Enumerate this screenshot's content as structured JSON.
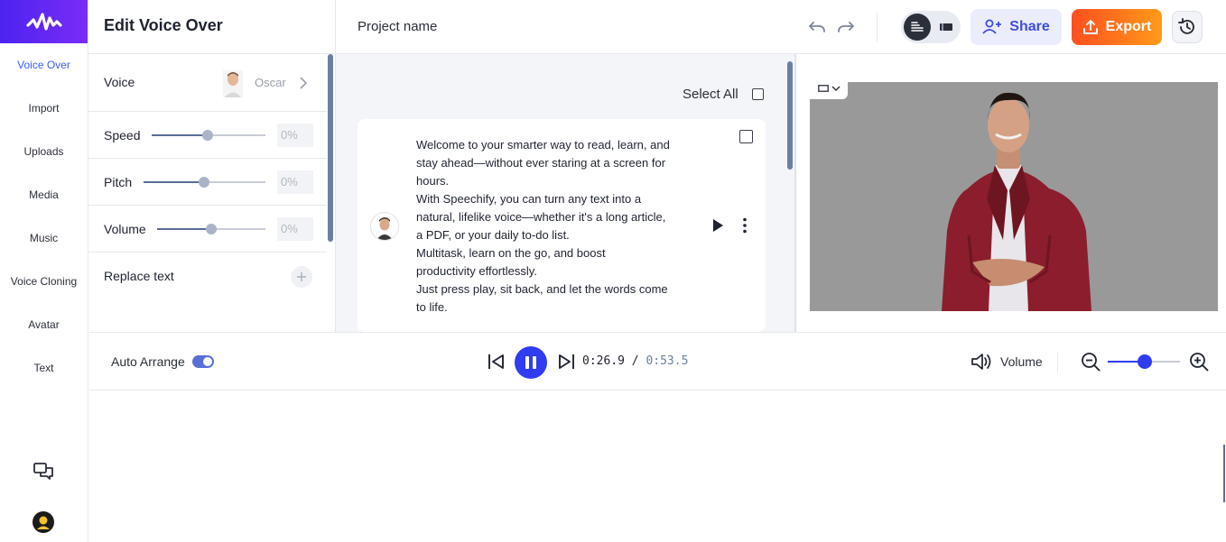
{
  "nav": {
    "items": [
      {
        "label": "Voice Over",
        "active": true
      },
      {
        "label": "Import"
      },
      {
        "label": "Uploads"
      },
      {
        "label": "Media"
      },
      {
        "label": "Music"
      },
      {
        "label": "Voice Cloning"
      },
      {
        "label": "Avatar"
      },
      {
        "label": "Text"
      }
    ],
    "bottom_icons": [
      "chat-icon",
      "user-avatar"
    ]
  },
  "edit_panel": {
    "title": "Edit Voice Over",
    "voice": {
      "label": "Voice",
      "value": "Oscar"
    },
    "speed": {
      "label": "Speed",
      "value": "0%",
      "level": 0.5
    },
    "pitch": {
      "label": "Pitch",
      "value": "0%",
      "level": 0.5
    },
    "volume": {
      "label": "Volume",
      "value": "0%",
      "level": 0.5
    },
    "replace_text": {
      "label": "Replace text"
    }
  },
  "header": {
    "project_name": "Project name",
    "share_label": "Share",
    "export_label": "Export"
  },
  "script": {
    "select_all_label": "Select All",
    "card_text": "Welcome to your smarter way to read, learn, and\nstay ahead—without ever staring at a screen for\nhours.\nWith Speechify, you can turn any text into a\nnatural, lifelike voice—whether it's a long article,\na PDF, or your daily to-do list.\nMultitask, learn on the go, and boost\nproductivity effortlessly.\nJust press play, sit back, and let the words come\nto life."
  },
  "playback": {
    "auto_arrange_label": "Auto Arrange",
    "auto_arrange_on": true,
    "current_time": "0:26.9",
    "separator": "/",
    "total_time": "0:53.5",
    "volume_label": "Volume",
    "zoom_level": 0.5
  },
  "colors": {
    "accent": "#2f3cf0",
    "brand_gradient_start": "#4d23f0",
    "export_gradient_start": "#ff4f1f",
    "export_gradient_end": "#ff9a1a",
    "stage_background": "#999999",
    "avatar_jacket": "#8b1d2c"
  }
}
